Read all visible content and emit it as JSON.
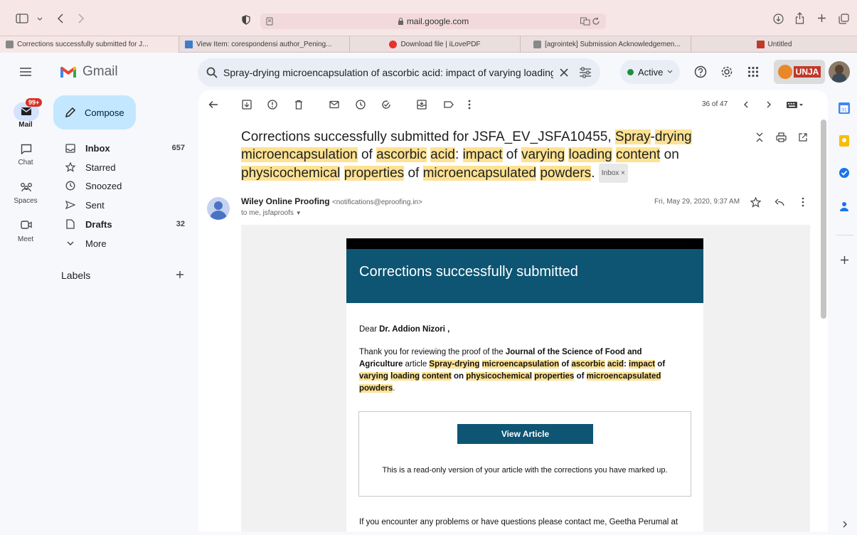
{
  "browser": {
    "url": "mail.google.com",
    "tabs": [
      {
        "label": "Corrections successfully submitted for J...",
        "active": true
      },
      {
        "label": "View Item: corespondensi author_Pening..."
      },
      {
        "label": "Download file | iLovePDF"
      },
      {
        "label": "[agrointek] Submission Acknowledgemen..."
      },
      {
        "label": "Untitled"
      }
    ]
  },
  "gmail": {
    "logo_text": "Gmail",
    "search_query": "Spray-drying microencapsulation of ascorbic acid: impact of varying loading",
    "status": "Active",
    "profile_badge": "UNJA",
    "rail": {
      "mail_badge": "99+",
      "mail": "Mail",
      "chat": "Chat",
      "spaces": "Spaces",
      "meet": "Meet"
    },
    "compose": "Compose",
    "nav": [
      {
        "label": "Inbox",
        "count": "657"
      },
      {
        "label": "Starred",
        "count": ""
      },
      {
        "label": "Snoozed",
        "count": ""
      },
      {
        "label": "Sent",
        "count": ""
      },
      {
        "label": "Drafts",
        "count": "32"
      },
      {
        "label": "More",
        "count": ""
      }
    ],
    "labels_heading": "Labels",
    "pager": "36 of 47"
  },
  "email": {
    "subject_parts": {
      "p1": "Corrections successfully submitted for JSFA_EV_JSFA10455, ",
      "h1": "Spray",
      "p2": "-",
      "h2": "drying",
      "p3": " ",
      "h3": "microencapsulation",
      "p4": " of ",
      "h4": "ascorbic",
      "p5": " ",
      "h5": "acid",
      "p6": ": ",
      "h6": "impact",
      "p7": " of ",
      "h7": "varying",
      "p8": " ",
      "h8": "loading",
      "p9": " ",
      "h9": "content",
      "p10": " on ",
      "h10": "physicochemical",
      "p11": " ",
      "h11": "properties",
      "p12": " of ",
      "h12": "microencapsulated",
      "p13": " ",
      "h13": "powders",
      "p14": "."
    },
    "inbox_chip": "Inbox ×",
    "sender_name": "Wiley Online Proofing",
    "sender_email": "<notifications@eproofing.in>",
    "to": "to me, jsfaproofs",
    "date": "Fri, May 29, 2020, 9:37 AM",
    "card_title": "Corrections successfully submitted",
    "dear_prefix": "Dear ",
    "dear_name": "Dr. Addion Nizori ,",
    "body": {
      "t1": "Thank you for reviewing the proof of the ",
      "journal": "Journal of the Science of Food and Agriculture",
      "t2": " article ",
      "a1": "Spray-drying",
      "a2": " ",
      "a3": "microencapsulation",
      "a4": " of ",
      "a5": "ascorbic",
      "a6": " ",
      "a7": "acid",
      "a8": ": ",
      "a9": "impact",
      "a10": " of ",
      "a11": "varying",
      "a12": " ",
      "a13": "loading",
      "a14": " ",
      "a15": "content",
      "a16": " on ",
      "a17": "physicochemical",
      "a18": " ",
      "a19": "properties",
      "a20": " of ",
      "a21": "microencapsulated",
      "a22": " ",
      "a23": "powders",
      "t3": "."
    },
    "view_button": "View Article",
    "readonly_note": "This is a read-only version of your article with the corrections you have marked up.",
    "contact_line": "If you encounter any problems or have questions please contact me, Geetha Perumal at"
  },
  "colors": {
    "wiley_blue": "#0d5573",
    "highlight": "#fde293",
    "compose_bg": "#c2e7ff"
  }
}
